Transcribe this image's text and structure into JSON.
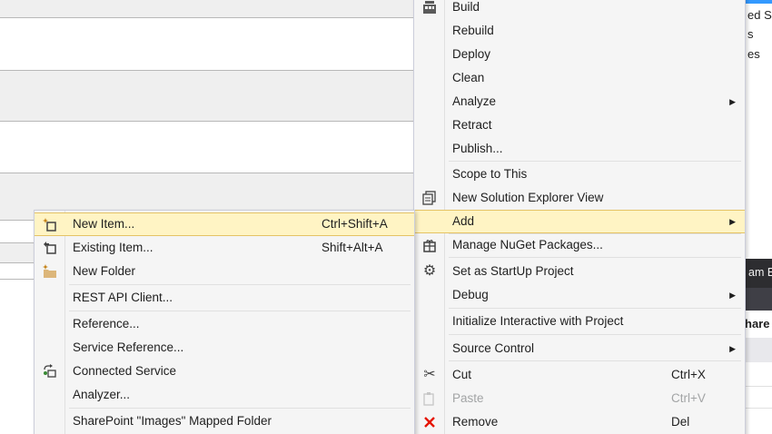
{
  "background": {
    "solution_explorer_fragments": [
      "ed Se",
      "s",
      "es"
    ],
    "team_explorer_fragment": "am E",
    "share_fragment": "hare"
  },
  "right_menu": {
    "items": [
      {
        "label": "Build",
        "icon": "build-icon"
      },
      {
        "label": "Rebuild"
      },
      {
        "label": "Deploy"
      },
      {
        "label": "Clean"
      },
      {
        "label": "Analyze",
        "submenu": true
      },
      {
        "label": "Retract"
      },
      {
        "label": "Publish..."
      },
      {
        "label": "Scope to This"
      },
      {
        "label": "New Solution Explorer View",
        "icon": "new-view-icon"
      },
      {
        "label": "Add",
        "submenu": true,
        "highlighted": true
      },
      {
        "label": "Manage NuGet Packages...",
        "icon": "nuget-icon"
      },
      {
        "label": "Set as StartUp Project",
        "icon": "gear-icon"
      },
      {
        "label": "Debug",
        "submenu": true
      },
      {
        "label": "Initialize Interactive with Project"
      },
      {
        "label": "Source Control",
        "submenu": true
      },
      {
        "label": "Cut",
        "shortcut": "Ctrl+X",
        "icon": "scissors-icon"
      },
      {
        "label": "Paste",
        "shortcut": "Ctrl+V",
        "icon": "paste-icon",
        "disabled": true
      },
      {
        "label": "Remove",
        "shortcut": "Del",
        "icon": "remove-icon"
      }
    ]
  },
  "left_menu": {
    "items": [
      {
        "label": "New Item...",
        "shortcut": "Ctrl+Shift+A",
        "icon": "new-item-icon",
        "highlighted": true
      },
      {
        "label": "Existing Item...",
        "shortcut": "Shift+Alt+A",
        "icon": "existing-item-icon"
      },
      {
        "label": "New Folder",
        "icon": "new-folder-icon"
      },
      {
        "label": "REST API Client..."
      },
      {
        "label": "Reference..."
      },
      {
        "label": "Service Reference..."
      },
      {
        "label": "Connected Service",
        "icon": "connected-service-icon"
      },
      {
        "label": "Analyzer..."
      },
      {
        "label": "SharePoint \"Images\" Mapped Folder"
      }
    ]
  },
  "colors": {
    "menu_bg": "#f5f5f5",
    "highlight_bg": "#fff4c4",
    "highlight_border": "#e5c365",
    "remove_icon": "#e51400",
    "disabled_text": "#a2a4a5"
  }
}
